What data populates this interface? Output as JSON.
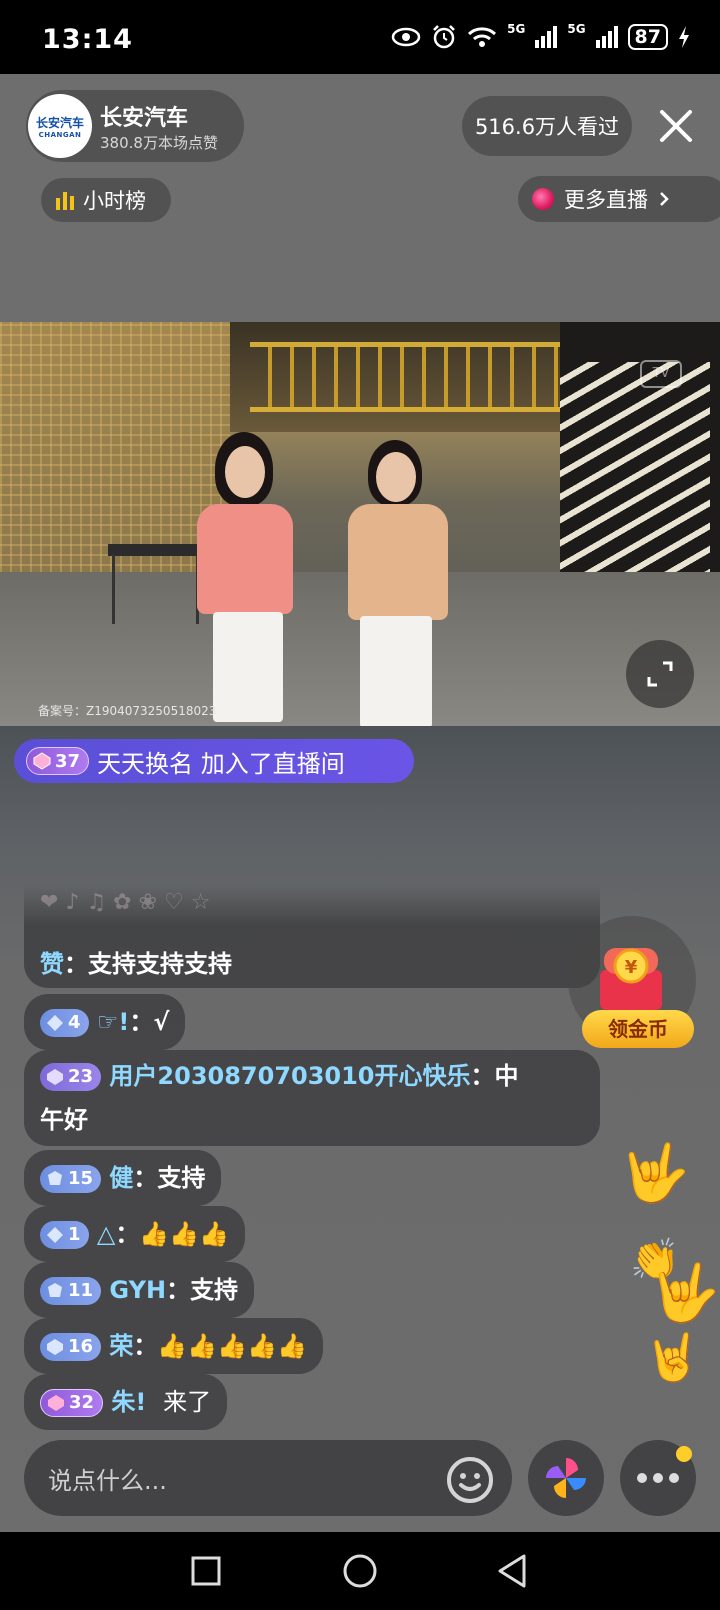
{
  "status_bar": {
    "time": "13:14",
    "battery": "87",
    "network_1": "5G",
    "network_2": "5G"
  },
  "anchor": {
    "avatar_text_cn": "长安汽车",
    "avatar_text_en": "CHANGAN",
    "name": "长安汽车",
    "likes": "380.8万本场点赞"
  },
  "viewers": "516.6万人看过",
  "hourly_rank_label": "小时榜",
  "more_live_label": "更多直播",
  "video": {
    "record_number": "备案号：Z1904073250518023",
    "tv_logo": "TV"
  },
  "join_banner": {
    "level": "37",
    "text": "天天换名 加入了直播间"
  },
  "chat": [
    {
      "level": "",
      "user": "赞",
      "message": "支持支持支持"
    },
    {
      "level": "4",
      "user": "☞!",
      "message": "√"
    },
    {
      "level": "23",
      "user": "用户2030870703010开心快乐",
      "message": "中",
      "message_line2": "午好"
    },
    {
      "level": "15",
      "user": "健",
      "message": "支持"
    },
    {
      "level": "1",
      "user": "△",
      "message": "👍👍👍"
    },
    {
      "level": "11",
      "user": "GYH",
      "message": "支持"
    },
    {
      "level": "16",
      "user": "荣",
      "message": "👍👍👍👍👍"
    },
    {
      "level": "32",
      "user": "朱!",
      "message": "来了"
    }
  ],
  "coin_widget_label": "领金币",
  "input_placeholder": "说点什么...",
  "colors": {
    "username": "#8fd8ff",
    "join_banner": "#5a4fd6",
    "coin_gold": "#ffd94a",
    "notify": "#ffcd2a"
  }
}
